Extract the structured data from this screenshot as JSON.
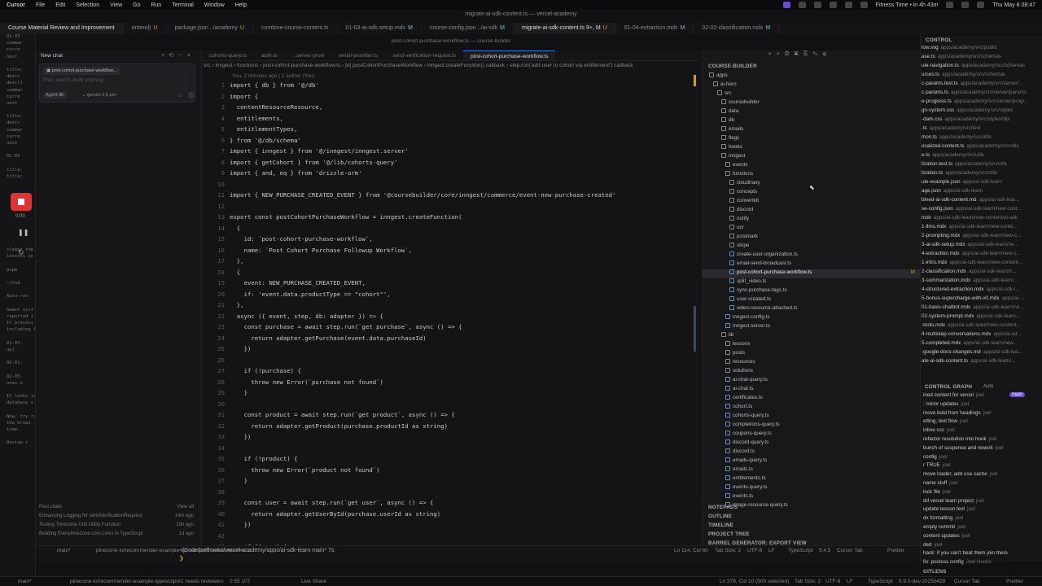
{
  "macbar": {
    "app": "Cursor",
    "menus": [
      "File",
      "Edit",
      "Selection",
      "View",
      "Go",
      "Run",
      "Terminal",
      "Window",
      "Help"
    ],
    "window_title": "migrate-ai-sdk-content.ts — vercel-academy",
    "fitness": "Fitness Time • in 4h 43m",
    "clock": "Thu May 8  08:47"
  },
  "window_tabs": [
    {
      "label": "Course Material Review and Improvement",
      "active": true,
      "badge": ""
    },
    {
      "label": "ontend)",
      "badge": "U"
    },
    {
      "label": "package.json ../academy",
      "badge": "U"
    },
    {
      "label": "combine-course-content.ts",
      "badge": ""
    },
    {
      "label": "01-03-ai-sdk-setup.mdx",
      "badge": "M"
    },
    {
      "label": "course-config.json ../ai-sdk",
      "badge": "M"
    },
    {
      "label": "migrate-ai-sdk-content.ts 9+, M",
      "badge": "U",
      "active2": true
    },
    {
      "label": "01-04-extraction.mdx",
      "badge": "M"
    },
    {
      "label": "02-02-classification.mdx",
      "badge": "M"
    }
  ],
  "subtitle": "post-cohort-purchase-workflow.ts — course-builder",
  "chat": {
    "title": "New chat",
    "attached": "post-cohort-purchase-workflow...",
    "placeholder": "Plan, search, build anything",
    "mode": "Agent",
    "shortcut": "⌘I",
    "model": "gemini-2.5-pro",
    "recorder_time": "0:00",
    "past_header": "Past chats",
    "view_all": "View all",
    "past": [
      {
        "label": "Enhancing Logging for sendVerificationRequest",
        "ago": "14m ago"
      },
      {
        "label": "Testing Timezone Unit Utility Function",
        "ago": "19h ago"
      },
      {
        "label": "Building Everytimezone.com Links in TypeScript",
        "ago": "1d ago"
      }
    ]
  },
  "left_strip": [
    "01-03",
    "summar",
    "curre",
    "next",
    "",
    "title:",
    "descr",
    "descri",
    "summar",
    "curre",
    "next",
    "",
    "title:",
    "descr",
    "summar",
    "curre",
    "next",
    "",
    "02-05",
    "",
    "title:",
    "title:",
    "",
    "",
    "",
    "",
    "",
    "",
    "",
    "",
    "",
    "",
    "clears the",
    "lessons co",
    "",
    "pnpm",
    "",
    "~/Cod",
    "",
    "Auto-ren",
    "",
    "Sweet vict",
    "reported i",
    "It process",
    "including t",
    "",
    "01-03-",
    "up)",
    "",
    "02-01-",
    "",
    "02-05-",
    "ones-u",
    "",
    "It looks lik",
    "database s",
    "",
    "Now, try ru",
    "the brows",
    "time.",
    "",
    "Review c"
  ],
  "editor_tabs": [
    {
      "label": "cohorts-query.ts"
    },
    {
      "label": "auth.ts"
    },
    {
      "label": "...server-provi"
    },
    {
      "label": "email-provider.ts"
    },
    {
      "label": "send-verification-request.ts"
    },
    {
      "label": "post-cohort-purchase-workflow.ts",
      "active": true
    }
  ],
  "breadcrumb": "src › inngest › functions › post-cohort-purchase-workflow.ts › [e] postCohortPurchaseWorkflow › inngest.createFunction() callback › step.run('add user to cohort via entitlement') callback",
  "blame": "You, 2 minutes ago | 1 author (You)",
  "code": [
    {
      "n": "1",
      "t": "import { db } from '@/db'"
    },
    {
      "n": "2",
      "t": "import {"
    },
    {
      "n": "3",
      "t": "  contentResourceResource,"
    },
    {
      "n": "4",
      "t": "  entitlements,"
    },
    {
      "n": "5",
      "t": "  entitlementTypes,"
    },
    {
      "n": "6",
      "t": "} from '@/db/schema'"
    },
    {
      "n": "7",
      "t": "import { inngest } from '@/inngest/inngest.server'"
    },
    {
      "n": "8",
      "t": "import { getCohort } from '@/lib/cohorts-query'"
    },
    {
      "n": "9",
      "t": "import { and, eq } from 'drizzle-orm'"
    },
    {
      "n": "10",
      "t": ""
    },
    {
      "n": "11",
      "t": "import { NEW_PURCHASE_CREATED_EVENT } from '@coursebuilder/core/inngest/commerce/event-new-purchase-created'"
    },
    {
      "n": "12",
      "t": ""
    },
    {
      "n": "13",
      "t": "export const postCohortPurchaseWorkflow = inngest.createFunction("
    },
    {
      "n": "14",
      "t": "  {"
    },
    {
      "n": "15",
      "t": "    id: `post-cohort-purchase-workflow`,"
    },
    {
      "n": "16",
      "t": "    name: `Post Cohort Purchase Followup Workflow`,"
    },
    {
      "n": "17",
      "t": "  },"
    },
    {
      "n": "18",
      "t": "  {"
    },
    {
      "n": "19",
      "t": "    event: NEW_PURCHASE_CREATED_EVENT,"
    },
    {
      "n": "20",
      "t": "    if: 'event.data.productType == \"cohort\"',"
    },
    {
      "n": "21",
      "t": "  },"
    },
    {
      "n": "22",
      "t": "  async ({ event, step, db: adapter }) => {"
    },
    {
      "n": "23",
      "t": "    const purchase = await step.run(`get purchase`, async () => {"
    },
    {
      "n": "24",
      "t": "      return adapter.getPurchase(event.data.purchaseId)"
    },
    {
      "n": "25",
      "t": "    })"
    },
    {
      "n": "26",
      "t": ""
    },
    {
      "n": "27",
      "t": "    if (!purchase) {"
    },
    {
      "n": "28",
      "t": "      throw new Error(`purchase not found`)"
    },
    {
      "n": "29",
      "t": "    }"
    },
    {
      "n": "30",
      "t": ""
    },
    {
      "n": "31",
      "t": "    const product = await step.run(`get product`, async () => {"
    },
    {
      "n": "32",
      "t": "      return adapter.getProduct(purchase.productId as string)"
    },
    {
      "n": "33",
      "t": "    })"
    },
    {
      "n": "34",
      "t": ""
    },
    {
      "n": "35",
      "t": "    if (!product) {"
    },
    {
      "n": "36",
      "t": "      throw new Error(`product not found`)"
    },
    {
      "n": "37",
      "t": "    }"
    },
    {
      "n": "38",
      "t": ""
    },
    {
      "n": "39",
      "t": "    const user = await step.run(`get user`, async () => {"
    },
    {
      "n": "40",
      "t": "      return adapter.getUserById(purchase.userId as string)"
    },
    {
      "n": "41",
      "t": "    })"
    },
    {
      "n": "42",
      "t": ""
    },
    {
      "n": "43",
      "t": "    if (!user) {"
    }
  ],
  "explorer": {
    "header": "COURSE-BUILDER",
    "rows": [
      {
        "l": "apps",
        "k": "folder",
        "d": 1
      },
      {
        "l": "ai-hero",
        "k": "folder",
        "d": 2
      },
      {
        "l": "src",
        "k": "folder",
        "d": 3
      },
      {
        "l": "coursebuilder",
        "k": "folder",
        "d": 4
      },
      {
        "l": "data",
        "k": "folder",
        "d": 4
      },
      {
        "l": "db",
        "k": "folder",
        "d": 4
      },
      {
        "l": "emails",
        "k": "folder",
        "d": 4
      },
      {
        "l": "flags",
        "k": "folder",
        "d": 4
      },
      {
        "l": "hooks",
        "k": "folder",
        "d": 4
      },
      {
        "l": "inngest",
        "k": "folder",
        "d": 4
      },
      {
        "l": "events",
        "k": "folder",
        "d": 5
      },
      {
        "l": "functions",
        "k": "folder",
        "d": 5
      },
      {
        "l": "cloudinary",
        "k": "folder",
        "d": 6
      },
      {
        "l": "concepts",
        "k": "folder",
        "d": 6
      },
      {
        "l": "convertkit",
        "k": "folder",
        "d": 6
      },
      {
        "l": "discord",
        "k": "folder",
        "d": 6
      },
      {
        "l": "notify",
        "k": "folder",
        "d": 6
      },
      {
        "l": "ocr",
        "k": "folder",
        "d": 6
      },
      {
        "l": "postmark",
        "k": "folder",
        "d": 6
      },
      {
        "l": "stripe",
        "k": "folder",
        "d": 6
      },
      {
        "l": "create-user-organization.ts",
        "k": "file",
        "d": 6
      },
      {
        "l": "email-send-broadcast.ts",
        "k": "file",
        "d": 6
      },
      {
        "l": "post-cohort-purchase-workflow.ts",
        "k": "file",
        "d": 6,
        "sel": true,
        "m": "M"
      },
      {
        "l": "split_video.ts",
        "k": "file",
        "d": 6
      },
      {
        "l": "sync-purchase-tags.ts",
        "k": "file",
        "d": 6
      },
      {
        "l": "user-created.ts",
        "k": "file",
        "d": 6
      },
      {
        "l": "video-resource-attached.ts",
        "k": "file",
        "d": 6
      },
      {
        "l": "inngest.config.ts",
        "k": "file",
        "d": 5
      },
      {
        "l": "inngest.server.ts",
        "k": "file",
        "d": 5
      },
      {
        "l": "lib",
        "k": "folder",
        "d": 4
      },
      {
        "l": "lessons",
        "k": "folder",
        "d": 5
      },
      {
        "l": "posts",
        "k": "folder",
        "d": 5
      },
      {
        "l": "resources",
        "k": "folder",
        "d": 5
      },
      {
        "l": "solutions",
        "k": "folder",
        "d": 5
      },
      {
        "l": "ai-chat-query.ts",
        "k": "file",
        "d": 5
      },
      {
        "l": "ai-chat.ts",
        "k": "file",
        "d": 5
      },
      {
        "l": "certificates.ts",
        "k": "file",
        "d": 5
      },
      {
        "l": "cohort.ts",
        "k": "file",
        "d": 5
      },
      {
        "l": "cohorts-query.ts",
        "k": "file",
        "d": 5
      },
      {
        "l": "completions-query.ts",
        "k": "file",
        "d": 5
      },
      {
        "l": "coupons-query.ts",
        "k": "file",
        "d": 5
      },
      {
        "l": "discord-query.ts",
        "k": "file",
        "d": 5
      },
      {
        "l": "discord.ts",
        "k": "file",
        "d": 5
      },
      {
        "l": "emails-query.ts",
        "k": "file",
        "d": 5
      },
      {
        "l": "emails.ts",
        "k": "file",
        "d": 5
      },
      {
        "l": "entitlements.ts",
        "k": "file",
        "d": 5
      },
      {
        "l": "events-query.ts",
        "k": "file",
        "d": 5
      },
      {
        "l": "events.ts",
        "k": "file",
        "d": 5
      },
      {
        "l": "image-resource-query.ts",
        "k": "file",
        "d": 5
      }
    ],
    "sections": [
      "NOTEPADS",
      "OUTLINE",
      "TIMELINE",
      "PROJECT TREE",
      "BARREL GENERATOR: EXPORT VIEW"
    ]
  },
  "right_panel": {
    "header": "CONTROL",
    "files": [
      {
        "n": "low.svg",
        "p": "apps/academy/src/public"
      },
      {
        "n": "ase.ts",
        "p": "apps/academy/src/schemas"
      },
      {
        "n": "ule-navigation.ts",
        "p": "apps/academy/src/schemas"
      },
      {
        "n": "urces.ts",
        "p": "apps/academy/src/schemas"
      },
      {
        "n": "c-params.test.ts",
        "p": "apps/academy/src/server/..."
      },
      {
        "n": "c-params.ts",
        "p": "apps/academy/src/server/params"
      },
      {
        "n": "e-progress.ts",
        "p": "apps/academy/src/server/progr..."
      },
      {
        "n": "gn-system.css",
        "p": "apps/academy/src/styles"
      },
      {
        "n": "-dark.css",
        "p": "apps/academy/src/styles/hljs"
      },
      {
        "n": ".ts",
        "p": "apps/academy/src/test"
      },
      {
        "n": "mon.ts",
        "p": "apps/academy/src/utils"
      },
      {
        "n": "ocalized-content.ts",
        "p": "apps/academy/src/utils"
      },
      {
        "n": "e.ts",
        "p": "apps/academy/src/utils"
      },
      {
        "n": "lization.test.ts",
        "p": "apps/academy/src/utils"
      },
      {
        "n": "lization.ts",
        "p": "apps/academy/src/utils"
      },
      {
        "n": "ule-example.json",
        "p": "apps/ai-sdk-learn"
      },
      {
        "n": "age.json",
        "p": "apps/ai-sdk-learn"
      },
      {
        "n": "bined-ai-sdk-content.md",
        "p": "apps/ai-sdk-lear..."
      },
      {
        "n": "se-config.json",
        "p": "apps/ai-sdk-learn/new-cont..."
      },
      {
        "n": "mdx",
        "p": "apps/ai-sdk-learn/new-content/ai-sdk"
      },
      {
        "n": "1-llms.mdx",
        "p": "apps/ai-sdk-learn/new-conte..."
      },
      {
        "n": "2-prompting.mdx",
        "p": "apps/ai-sdk-learn/new-c..."
      },
      {
        "n": "3-ai-sdk-setup.mdx",
        "p": "apps/ai-sdk-learn/ne..."
      },
      {
        "n": "4-extraction.mdx",
        "p": "apps/ai-sdk-learn/new-c..."
      },
      {
        "n": "1-intro.mdx",
        "p": "apps/ai-sdk-learn/new-content..."
      },
      {
        "n": "2-classification.mdx",
        "p": "apps/ai-sdk-learn/n..."
      },
      {
        "n": "3-summarization.mdx",
        "p": "apps/ai-sdk-learn/..."
      },
      {
        "n": "4-structured-extraction.mdx",
        "p": "apps/ai-sdk-l..."
      },
      {
        "n": "5-bonus-supercharge-with-v0.mdx",
        "p": "apps/ai-..."
      },
      {
        "n": "01-basic-chatbot.mdx",
        "p": "apps/ai-sdk-learn/ne..."
      },
      {
        "n": "02-system-prompt.mdx",
        "p": "apps/ai-sdk-learn..."
      },
      {
        "n": "-tools.mdx",
        "p": "apps/ai-sdk-learn/new-content..."
      },
      {
        "n": "4-multistep-conversations.mdx",
        "p": "apps/ai-sd..."
      },
      {
        "n": "5-completed.mdx",
        "p": "apps/ai-sdk-learn/new..."
      },
      {
        "n": "-google-docs-changes.md",
        "p": "apps/ai-sdk-lea..."
      },
      {
        "n": "ate-ai-sdk-content.ts",
        "p": "apps/ai-sdk-learn/..."
      }
    ],
    "graph_header": "CONTROL GRAPH",
    "graph_auto": "Auto",
    "graph_branch": "main",
    "commits": [
      {
        "m": "ined content for vercel",
        "a": "joel"
      },
      {
        "m": ": minor updates",
        "a": "joel"
      },
      {
        "m": "move bold from headings",
        "a": "joel"
      },
      {
        "m": "etting, text flow",
        "a": "joel"
      },
      {
        "m": "inline css",
        "a": "joel"
      },
      {
        "m": "refactor resolution into hook",
        "a": "joel"
      },
      {
        "m": "bunch of suspense and rework",
        "a": "joel"
      },
      {
        "m": "config",
        "a": "joel"
      },
      {
        "m": "r TRUE",
        "a": "joel"
      },
      {
        "m": "move loader, add use cache",
        "a": "joel"
      },
      {
        "m": "name stuff",
        "a": "joel"
      },
      {
        "m": "lock file",
        "a": "joel"
      },
      {
        "m": "dd vercel learn project",
        "a": "joel"
      },
      {
        "m": "update lesson text",
        "a": "joel"
      },
      {
        "m": "dx formatting",
        "a": "joel"
      },
      {
        "m": "empty commit",
        "a": "joel"
      },
      {
        "m": "content updates",
        "a": "joel"
      },
      {
        "m": "ded",
        "a": "joel"
      },
      {
        "m": "hack: if you can't beat them join them",
        "a": "joel"
      },
      {
        "m": "fix: postcss config",
        "a": "Joel Hooks"
      }
    ],
    "gitlens": "GITLENS"
  },
  "terminal": {
    "prompt": "~/Code/joelhooks/vercel-academy/apps/ai-sdk-learn main* 7s",
    "caret": "❯"
  },
  "status_upper": {
    "branch": "main*",
    "pr": "pinecone-io/recommender-example-typescript#1 needs reviewers",
    "ln": "Ln 114, Col 60",
    "tab": "Tab Size: 2",
    "enc": "UTF-8",
    "lf": "LF",
    "lang": "TypeScript",
    "ver": "5.4.5",
    "cursor_tab": "Cursor Tab",
    "prettier": "Prettier"
  },
  "status_lower": {
    "branch": "main*",
    "pr": "pinecone-io/recommender-example-typescript#1 needs reviewers",
    "counts": "0  55  107",
    "live": "Live Share",
    "ln": "Ln 379, Col 10 (505 selected)",
    "tab": "Tab Size: 2",
    "enc": "UTF-8",
    "lf": "LF",
    "lang": "TypeScript",
    "ver": "5.9.0-dev.20250428",
    "cursor_tab": "Cursor Tab",
    "prettier": "Prettier"
  }
}
